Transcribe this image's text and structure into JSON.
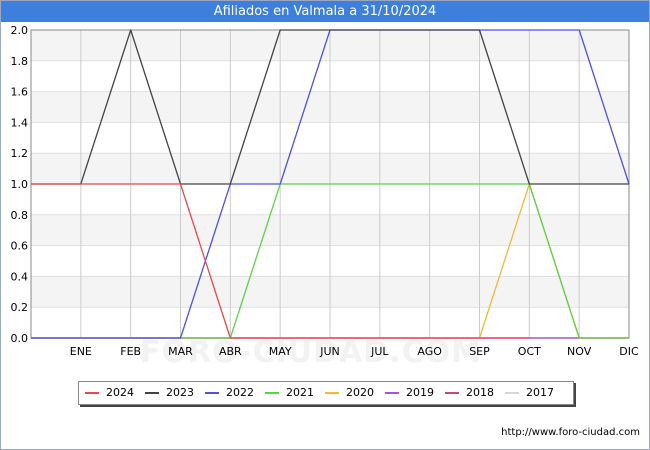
{
  "header": {
    "title": "Afiliados en Valmala a 31/10/2024"
  },
  "footer": {
    "url": "http://www.foro-ciudad.com"
  },
  "watermark": {
    "text": "FORO-CIUDAD.COM"
  },
  "chart_data": {
    "type": "line",
    "title": "Afiliados en Valmala a 31/10/2024",
    "categories": [
      "",
      "ENE",
      "FEB",
      "MAR",
      "ABR",
      "MAY",
      "JUN",
      "JUL",
      "AGO",
      "SEP",
      "OCT",
      "NOV",
      "DIC"
    ],
    "ylim": [
      0,
      2
    ],
    "yticks": [
      "0.0",
      "0.2",
      "0.4",
      "0.6",
      "0.8",
      "1.0",
      "1.2",
      "1.4",
      "1.6",
      "1.8",
      "2.0"
    ],
    "grid": true,
    "legend_position": "bottom",
    "series": [
      {
        "name": "2017",
        "color": "#d8d8d8",
        "values": [
          0,
          0,
          0,
          0,
          0,
          0,
          0,
          0,
          0,
          0,
          0,
          0,
          0
        ]
      },
      {
        "name": "2018",
        "color": "#bf4d7a",
        "values": [
          0,
          0,
          0,
          0,
          0,
          0,
          0,
          0,
          0,
          0,
          0,
          0,
          0
        ]
      },
      {
        "name": "2019",
        "color": "#a550e6",
        "values": [
          0,
          0,
          0,
          0,
          0,
          0,
          0,
          0,
          0,
          0,
          0,
          0,
          0
        ]
      },
      {
        "name": "2020",
        "color": "#f5b63c",
        "values": [
          0,
          0,
          0,
          0,
          0,
          0,
          0,
          0,
          0,
          0,
          1,
          0,
          0
        ]
      },
      {
        "name": "2021",
        "color": "#5ed14a",
        "values": [
          0,
          0,
          0,
          0,
          0,
          1,
          1,
          1,
          1,
          1,
          1,
          0,
          0
        ]
      },
      {
        "name": "2022",
        "color": "#5050e6",
        "values": [
          0,
          0,
          0,
          0,
          1,
          1,
          2,
          2,
          2,
          2,
          2,
          2,
          1
        ]
      },
      {
        "name": "2023",
        "color": "#444444",
        "values": [
          1,
          1,
          2,
          1,
          1,
          2,
          2,
          2,
          2,
          2,
          1,
          1,
          1
        ]
      },
      {
        "name": "2024",
        "color": "#ea4848",
        "values": [
          1,
          1,
          1,
          1,
          0,
          0,
          0,
          0,
          0,
          0,
          0
        ]
      }
    ],
    "legend_order": [
      "2024",
      "2023",
      "2022",
      "2021",
      "2020",
      "2019",
      "2018",
      "2017"
    ]
  }
}
